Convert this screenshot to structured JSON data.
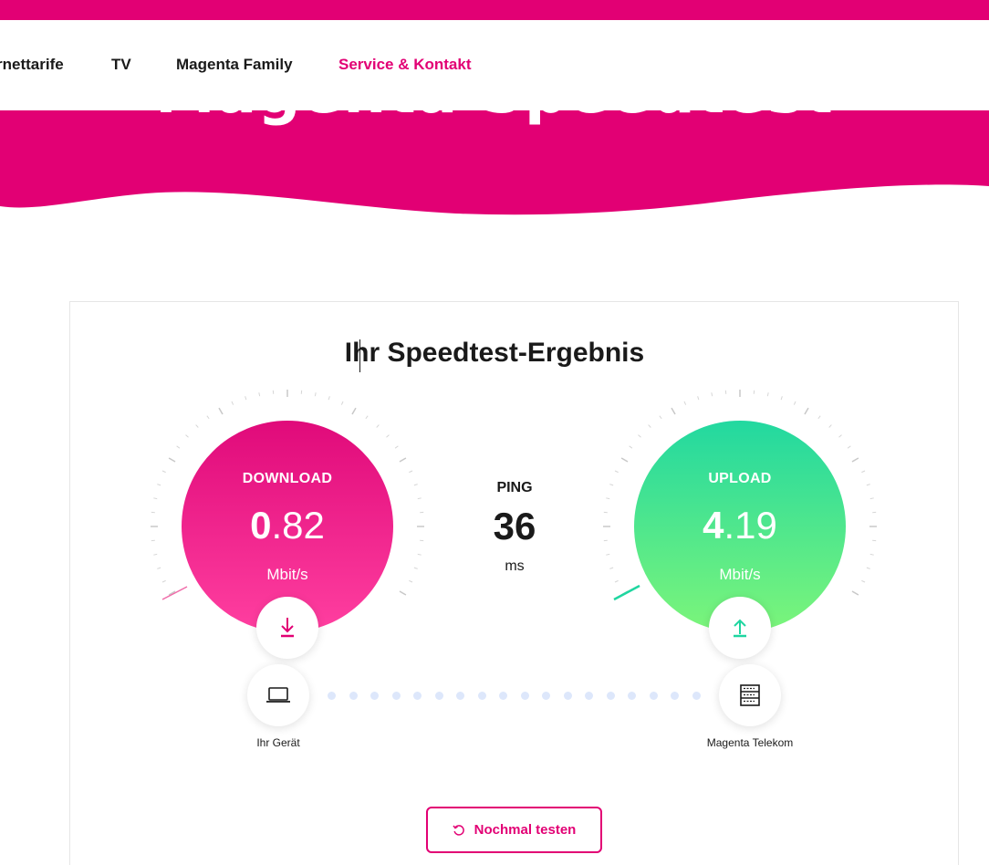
{
  "header": {
    "nav": [
      {
        "label": "rnettarife",
        "active": false
      },
      {
        "label": "TV",
        "active": false
      },
      {
        "label": "Magenta Family",
        "active": false
      },
      {
        "label": "Service & Kontakt",
        "active": true
      }
    ]
  },
  "hero": {
    "title": "Magenta Speedtest"
  },
  "result": {
    "title": "Ihr Speedtest-Ergebnis",
    "download": {
      "label": "DOWNLOAD",
      "value_int": "0",
      "value_dec": ".82",
      "unit": "Mbit/s",
      "icon": "download-arrow-icon"
    },
    "ping": {
      "label": "PING",
      "value": "36",
      "unit": "ms"
    },
    "upload": {
      "label": "UPLOAD",
      "value_int": "4",
      "value_dec": ".19",
      "unit": "Mbit/s",
      "icon": "upload-arrow-icon"
    },
    "device": {
      "label": "Ihr Gerät",
      "icon": "laptop-icon"
    },
    "server": {
      "label": "Magenta Telekom",
      "icon": "server-icon"
    },
    "retry_button": {
      "label": "Nochmal testen",
      "icon": "refresh-icon"
    }
  },
  "colors": {
    "brand": "#e20074",
    "download_gradient": [
      "#e00a7a",
      "#ff3fa0"
    ],
    "upload_gradient": [
      "#22d8a0",
      "#7cf57a"
    ],
    "connection_dots": "#dde7fb"
  }
}
